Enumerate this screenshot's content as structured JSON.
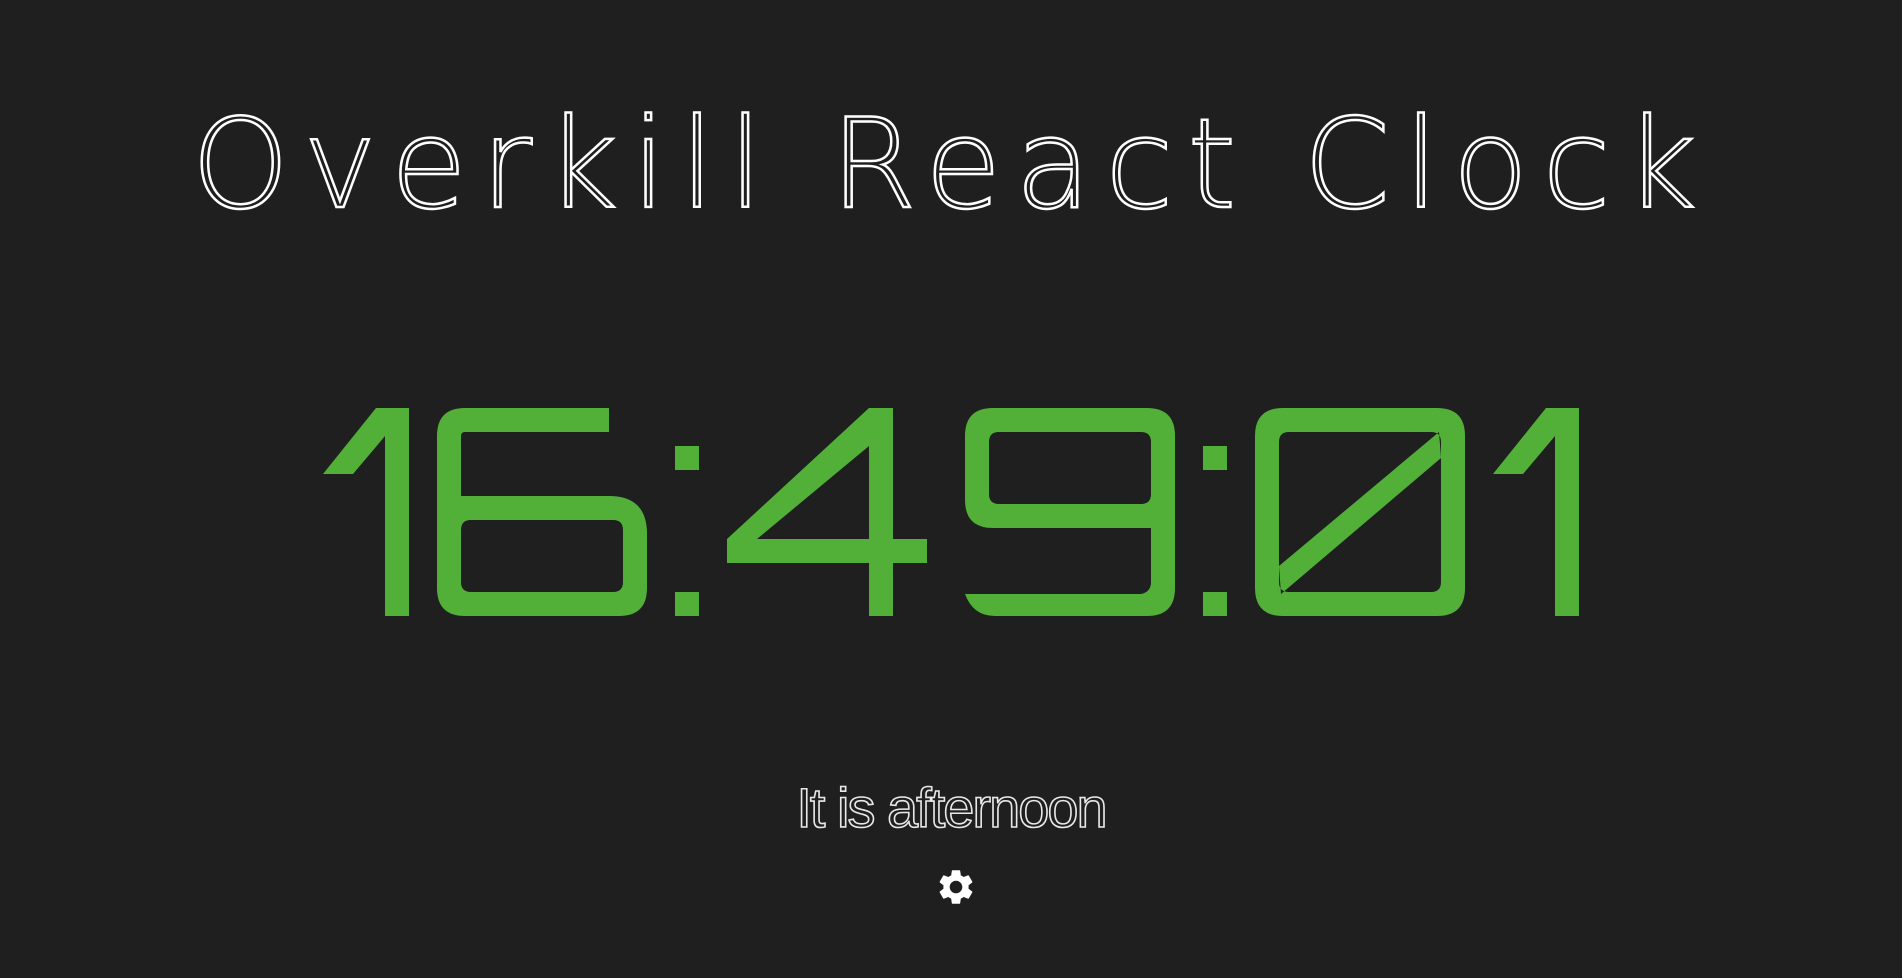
{
  "app": {
    "title": "Overkill React Clock"
  },
  "clock": {
    "time": "16:49:01",
    "color": "#52b038"
  },
  "greeting": {
    "text": "It is afternoon"
  },
  "settings": {
    "icon": "gear-icon"
  },
  "colors": {
    "background": "#1f1f1f",
    "text": "#ffffff",
    "accent": "#52b038"
  }
}
